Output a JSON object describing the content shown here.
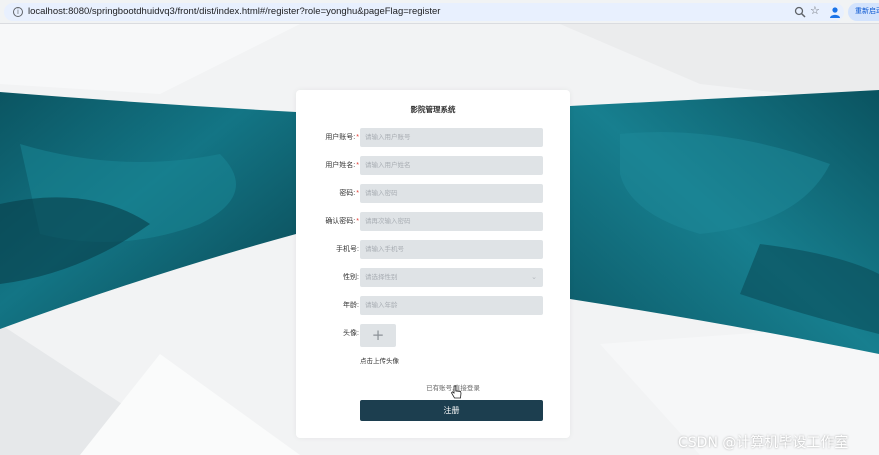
{
  "browser": {
    "url": "localhost:8080/springbootdhuidvq3/front/dist/index.html#/register?role=yonghu&pageFlag=register",
    "restart_label": "重新启动",
    "info_glyph": "i",
    "star_glyph": "☆"
  },
  "form": {
    "title": "影院管理系统",
    "required_mark": "*",
    "fields": [
      {
        "label": "用户账号:",
        "required": true,
        "placeholder": "请输入用户账号"
      },
      {
        "label": "用户姓名:",
        "required": true,
        "placeholder": "请输入用户姓名"
      },
      {
        "label": "密码:",
        "required": true,
        "placeholder": "请输入密码"
      },
      {
        "label": "确认密码:",
        "required": true,
        "placeholder": "请再次输入密码"
      },
      {
        "label": "手机号:",
        "required": false,
        "placeholder": "请输入手机号"
      },
      {
        "label": "性别:",
        "required": false,
        "placeholder": "请选择性别",
        "type": "select"
      },
      {
        "label": "年龄:",
        "required": false,
        "placeholder": "请输入年龄"
      }
    ],
    "avatar": {
      "label": "头像:",
      "plus_glyph": "+",
      "hint": "点击上传头像"
    },
    "select_chevron": "⌄",
    "login_link": "已有账号,直接登录",
    "submit_label": "注册"
  },
  "watermark": "CSDN @计算机毕设工作室",
  "colors": {
    "accent": "#1c3e4f",
    "input_bg": "#dfe3e6",
    "required": "#e0352b",
    "teal": "#0e6472"
  }
}
